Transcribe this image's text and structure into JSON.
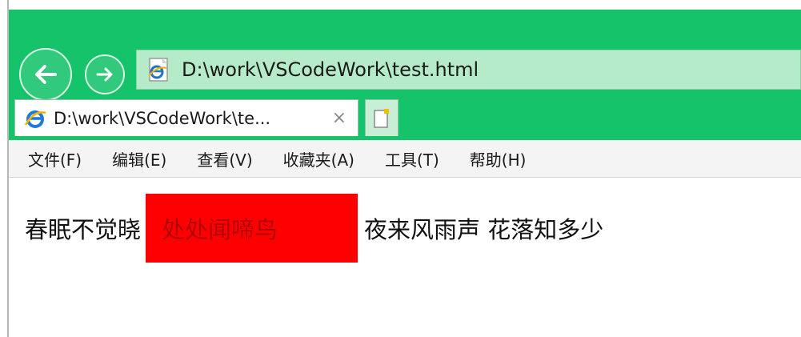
{
  "browser": {
    "address": "D:\\work\\VSCodeWork\\test.html",
    "tab_title": "D:\\work\\VSCodeWork\\te...",
    "tab_close": "×"
  },
  "menu": {
    "items": [
      {
        "label": "文件(F)"
      },
      {
        "label": "编辑(E)"
      },
      {
        "label": "查看(V)"
      },
      {
        "label": "收藏夹(A)"
      },
      {
        "label": "工具(T)"
      },
      {
        "label": "帮助(H)"
      }
    ]
  },
  "page": {
    "text_before": "春眠不觉晓",
    "highlight_text": "处处闻啼鸟",
    "text_after": "夜来风雨声 花落知多少"
  },
  "colors": {
    "chrome_green": "#15c36a",
    "highlight_bg": "#ff0000",
    "highlight_text": "#b00000"
  },
  "icons": [
    "back-arrow-icon",
    "forward-arrow-icon",
    "ie-page-icon",
    "ie-logo-icon",
    "new-tab-icon"
  ]
}
